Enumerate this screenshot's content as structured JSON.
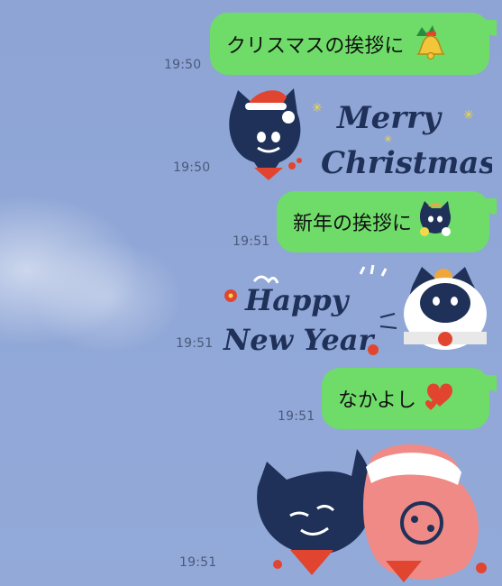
{
  "messages": [
    {
      "type": "text",
      "text": "クリスマスの挨拶に",
      "time": "19:50",
      "emoji": "bell-emoji"
    },
    {
      "type": "sticker",
      "sticker_text": "Merry Christmas",
      "time": "19:50",
      "sticker": "cat-santa-sticker"
    },
    {
      "type": "text",
      "text": "新年の挨拶に",
      "time": "19:51",
      "emoji": "cat-emoji"
    },
    {
      "type": "sticker",
      "sticker_text": "Happy New Year",
      "time": "19:51",
      "sticker": "cat-kagamimochi-sticker"
    },
    {
      "type": "text",
      "text": "なかよし",
      "time": "19:51",
      "emoji": "hearts-emoji"
    },
    {
      "type": "sticker",
      "sticker_text": "",
      "time": "19:51",
      "sticker": "cat-friends-sticker"
    }
  ],
  "colors": {
    "bubble": "#6fdc69",
    "background": "#8fa6d6",
    "cat_navy": "#1f3158",
    "accent_red": "#e2452f",
    "accent_yellow": "#f3d94a"
  }
}
